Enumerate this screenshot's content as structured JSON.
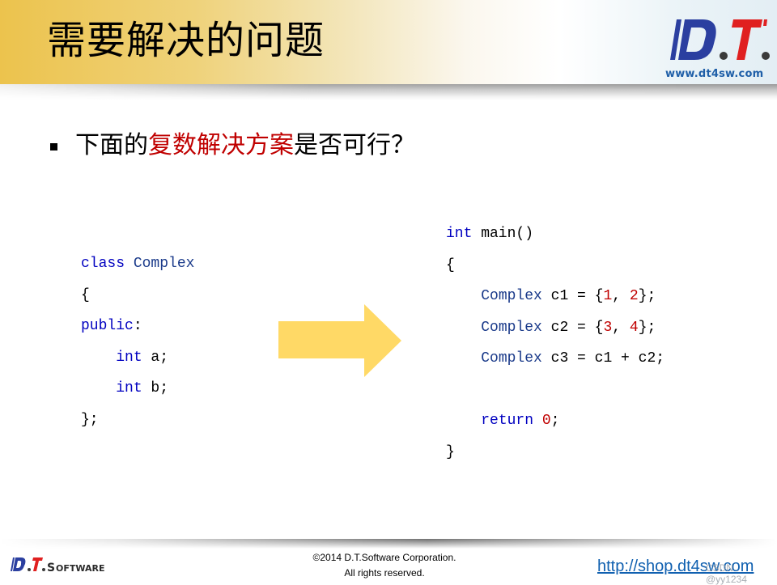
{
  "header": {
    "title": "需要解决的问题",
    "logo": {
      "letters": [
        "D",
        ".",
        "T",
        "."
      ],
      "url": "www.dt4sw.com"
    },
    "colors": {
      "band_start": "#ecc34d",
      "logo_blue": "#2b3fa0",
      "logo_red": "#e02020"
    }
  },
  "bullet": {
    "marker_icon": "square-bullet",
    "segments": [
      {
        "text": "下面的",
        "highlight": false
      },
      {
        "text": "复数解决方案",
        "highlight": true
      },
      {
        "text": "是否可行？",
        "highlight": false
      }
    ],
    "highlight_color": "#c00000"
  },
  "code_left": {
    "lines": [
      [
        {
          "t": "class ",
          "c": "kw"
        },
        {
          "t": "Complex",
          "c": "ty"
        }
      ],
      [
        {
          "t": "{",
          "c": ""
        }
      ],
      [
        {
          "t": "public",
          "c": "kw"
        },
        {
          "t": ":",
          "c": ""
        }
      ],
      [
        {
          "t": "    ",
          "c": ""
        },
        {
          "t": "int",
          "c": "kw"
        },
        {
          "t": " a;",
          "c": ""
        }
      ],
      [
        {
          "t": "    ",
          "c": ""
        },
        {
          "t": "int",
          "c": "kw"
        },
        {
          "t": " b;",
          "c": ""
        }
      ],
      [
        {
          "t": "};",
          "c": ""
        }
      ]
    ]
  },
  "arrow": {
    "icon": "right-arrow-icon",
    "color": "#ffd966"
  },
  "code_right": {
    "lines": [
      [
        {
          "t": "int",
          "c": "kw"
        },
        {
          "t": " main()",
          "c": ""
        }
      ],
      [
        {
          "t": "{",
          "c": ""
        }
      ],
      [
        {
          "t": "    ",
          "c": ""
        },
        {
          "t": "Complex",
          "c": "ty"
        },
        {
          "t": " c1 = {",
          "c": ""
        },
        {
          "t": "1",
          "c": "num"
        },
        {
          "t": ", ",
          "c": ""
        },
        {
          "t": "2",
          "c": "num"
        },
        {
          "t": "};",
          "c": ""
        }
      ],
      [
        {
          "t": "    ",
          "c": ""
        },
        {
          "t": "Complex",
          "c": "ty"
        },
        {
          "t": " c2 = {",
          "c": ""
        },
        {
          "t": "3",
          "c": "num"
        },
        {
          "t": ", ",
          "c": ""
        },
        {
          "t": "4",
          "c": "num"
        },
        {
          "t": "};",
          "c": ""
        }
      ],
      [
        {
          "t": "    ",
          "c": ""
        },
        {
          "t": "Complex",
          "c": "ty"
        },
        {
          "t": " c3 = c1 + c2;",
          "c": ""
        }
      ],
      [
        {
          "t": "",
          "c": ""
        }
      ],
      [
        {
          "t": "    ",
          "c": ""
        },
        {
          "t": "return",
          "c": "kw"
        },
        {
          "t": " ",
          "c": ""
        },
        {
          "t": "0",
          "c": "num"
        },
        {
          "t": ";",
          "c": ""
        }
      ],
      [
        {
          "t": "}",
          "c": ""
        }
      ]
    ]
  },
  "footer": {
    "logo_text": "SOFTWARE",
    "copyright_line1": "©2014 D.T.Software Corporation.",
    "copyright_line2": "All rights reserved.",
    "link": "http://shop.dt4sw.com",
    "watermark": "CSDN @yy1234"
  }
}
